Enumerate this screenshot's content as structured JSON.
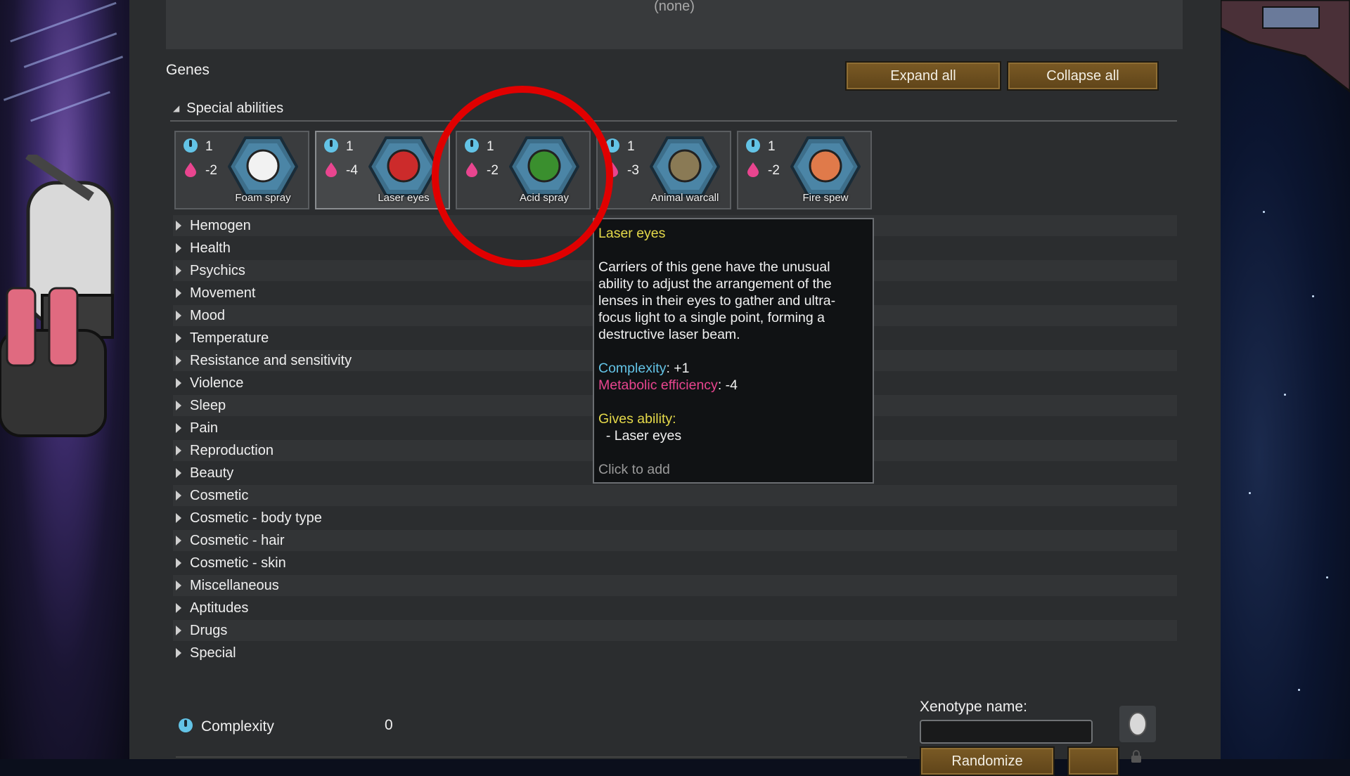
{
  "top_box": {
    "none_label": "(none)"
  },
  "genes": {
    "title": "Genes",
    "expand_all": "Expand all",
    "collapse_all": "Collapse all"
  },
  "special_abilities": {
    "header": "Special abilities",
    "cards": [
      {
        "complexity": "1",
        "metabolic": "-2",
        "name": "Foam spray",
        "icon": "foam-spray-icon",
        "color": "#f2f2f2"
      },
      {
        "complexity": "1",
        "metabolic": "-4",
        "name": "Laser eyes",
        "icon": "laser-eyes-icon",
        "color": "#cc2b2b"
      },
      {
        "complexity": "1",
        "metabolic": "-2",
        "name": "Acid spray",
        "icon": "acid-spray-icon",
        "color": "#3a8f2e"
      },
      {
        "complexity": "1",
        "metabolic": "-3",
        "name": "Animal warcall",
        "icon": "animal-warcall-icon",
        "color": "#8a7a55"
      },
      {
        "complexity": "1",
        "metabolic": "-2",
        "name": "Fire spew",
        "icon": "fire-spew-icon",
        "color": "#e07a4a"
      }
    ]
  },
  "categories": [
    "Hemogen",
    "Health",
    "Psychics",
    "Movement",
    "Mood",
    "Temperature",
    "Resistance and sensitivity",
    "Violence",
    "Sleep",
    "Pain",
    "Reproduction",
    "Beauty",
    "Cosmetic",
    "Cosmetic - body type",
    "Cosmetic - hair",
    "Cosmetic - skin",
    "Miscellaneous",
    "Aptitudes",
    "Drugs",
    "Special"
  ],
  "tooltip": {
    "title": "Laser eyes",
    "description": "Carriers of this gene have the unusual ability to adjust the arrangement of the lenses in their eyes to gather and ultra-focus light to a single point, forming a destructive laser beam.",
    "complexity_label": "Complexity",
    "complexity_value": ": +1",
    "metabolic_label": "Metabolic efficiency",
    "metabolic_value": ": -4",
    "gives_ability_label": "Gives ability:",
    "ability": "  - Laser eyes",
    "click_hint": "Click to add"
  },
  "footer": {
    "complexity_label": "Complexity",
    "complexity_value": "0",
    "xenotype_label": "Xenotype name:",
    "xenotype_value": "",
    "randomize": "Randomize"
  },
  "colors": {
    "complexity": "#63c3e6",
    "metabolic": "#e9458f",
    "highlight": "#e00000",
    "button": "#6b4e1f"
  }
}
